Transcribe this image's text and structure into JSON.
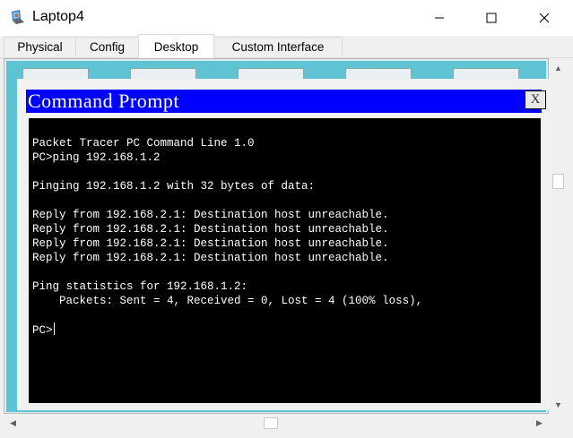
{
  "window": {
    "title": "Laptop4",
    "controls": {
      "minimize": "—",
      "maximize": "☐",
      "close": "✕"
    }
  },
  "tabs": [
    {
      "label": "Physical",
      "active": false
    },
    {
      "label": "Config",
      "active": false
    },
    {
      "label": "Desktop",
      "active": true
    },
    {
      "label": "Custom Interface",
      "active": false
    }
  ],
  "command_prompt": {
    "title": "Command Prompt",
    "close_label": "X",
    "lines": [
      "Packet Tracer PC Command Line 1.0",
      "PC>ping 192.168.1.2",
      "",
      "Pinging 192.168.1.2 with 32 bytes of data:",
      "",
      "Reply from 192.168.2.1: Destination host unreachable.",
      "Reply from 192.168.2.1: Destination host unreachable.",
      "Reply from 192.168.2.1: Destination host unreachable.",
      "Reply from 192.168.2.1: Destination host unreachable.",
      "",
      "Ping statistics for 192.168.1.2:",
      "    Packets: Sent = 4, Received = 0, Lost = 4 (100% loss),",
      ""
    ],
    "prompt": "PC>"
  },
  "colors": {
    "cmd_titlebar": "#0000ff",
    "terminal_bg": "#000000",
    "terminal_fg": "#ffffff",
    "desktop_bg": "#5fc3d3"
  },
  "icons": {
    "app": "packet-tracer-laptop-icon",
    "scroll_up": "▲",
    "scroll_down": "▼",
    "scroll_left": "◀",
    "scroll_right": "▶"
  }
}
